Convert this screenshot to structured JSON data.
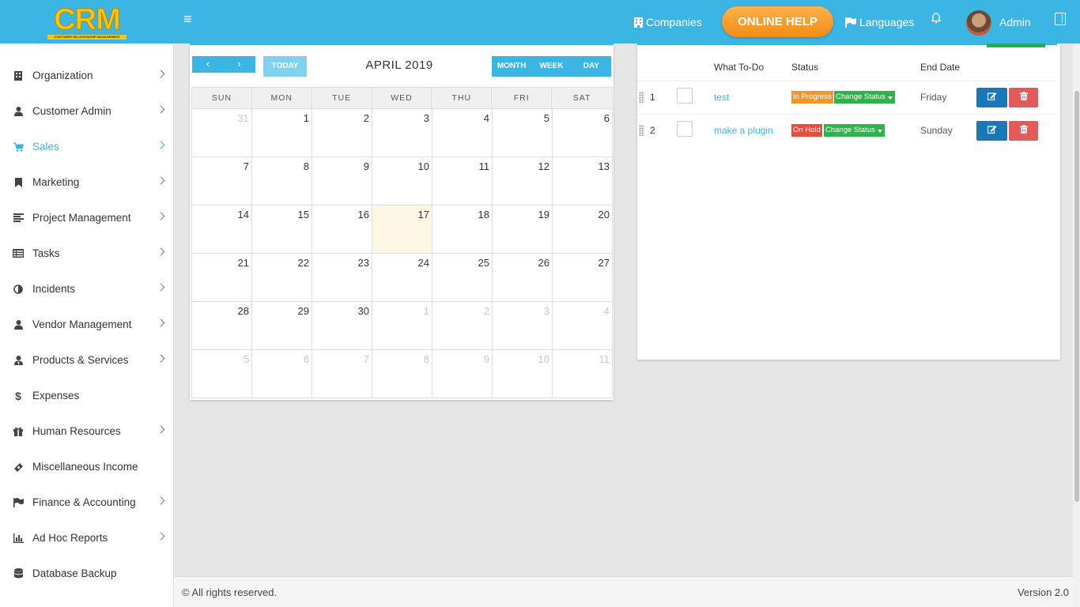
{
  "header": {
    "logo_text": "CRM",
    "logo_subtitle": "CUSTOMER RELATIONSHIP MANAGEMENT",
    "companies_label": "Companies",
    "online_help_label": "ONLINE HELP",
    "languages_label": "Languages",
    "user_name": "Admin"
  },
  "sidebar": {
    "items": [
      {
        "label": "Organization"
      },
      {
        "label": "Customer Admin"
      },
      {
        "label": "Sales"
      },
      {
        "label": "Marketing"
      },
      {
        "label": "Project Management"
      },
      {
        "label": "Tasks"
      },
      {
        "label": "Incidents"
      },
      {
        "label": "Vendor Management"
      },
      {
        "label": "Products & Services"
      },
      {
        "label": "Expenses"
      },
      {
        "label": "Human Resources"
      },
      {
        "label": "Miscellaneous Income"
      },
      {
        "label": "Finance & Accounting"
      },
      {
        "label": "Ad Hoc Reports"
      },
      {
        "label": "Database Backup"
      }
    ],
    "active_item": "Sales"
  },
  "calendar": {
    "prev_icon": "‹",
    "next_icon": "›",
    "today_label": "TODAY",
    "title": "APRIL 2019",
    "views": [
      "MONTH",
      "WEEK",
      "DAY"
    ],
    "weekdays": [
      "SUN",
      "MON",
      "TUE",
      "WED",
      "THU",
      "FRI",
      "SAT"
    ],
    "weeks": [
      [
        "31",
        "1",
        "2",
        "3",
        "4",
        "5",
        "6"
      ],
      [
        "7",
        "8",
        "9",
        "10",
        "11",
        "12",
        "13"
      ],
      [
        "14",
        "15",
        "16",
        "17",
        "18",
        "19",
        "20"
      ],
      [
        "21",
        "22",
        "23",
        "24",
        "25",
        "26",
        "27"
      ],
      [
        "28",
        "29",
        "30",
        "1",
        "2",
        "3",
        "4"
      ],
      [
        "5",
        "6",
        "7",
        "8",
        "9",
        "10",
        "11"
      ]
    ],
    "today": "17"
  },
  "todo": {
    "columns": {
      "task": "What To-Do",
      "status": "Status",
      "end_date": "End Date"
    },
    "rows": [
      {
        "num": "1",
        "task": "test",
        "status": "In Progress",
        "change_label": "Change Status",
        "end_date": "Friday"
      },
      {
        "num": "2",
        "task": "make a plugin",
        "status": "On Hold",
        "change_label": "Change Status",
        "end_date": "Sunday"
      }
    ]
  },
  "footer": {
    "copyright": "© All rights reserved.",
    "version": "Version 2.0"
  },
  "colors": {
    "primary": "#3bb5e3",
    "orange": "#f0972a",
    "green": "#2eb44a",
    "red": "#e74c3c",
    "edit_blue": "#1a78b8"
  }
}
